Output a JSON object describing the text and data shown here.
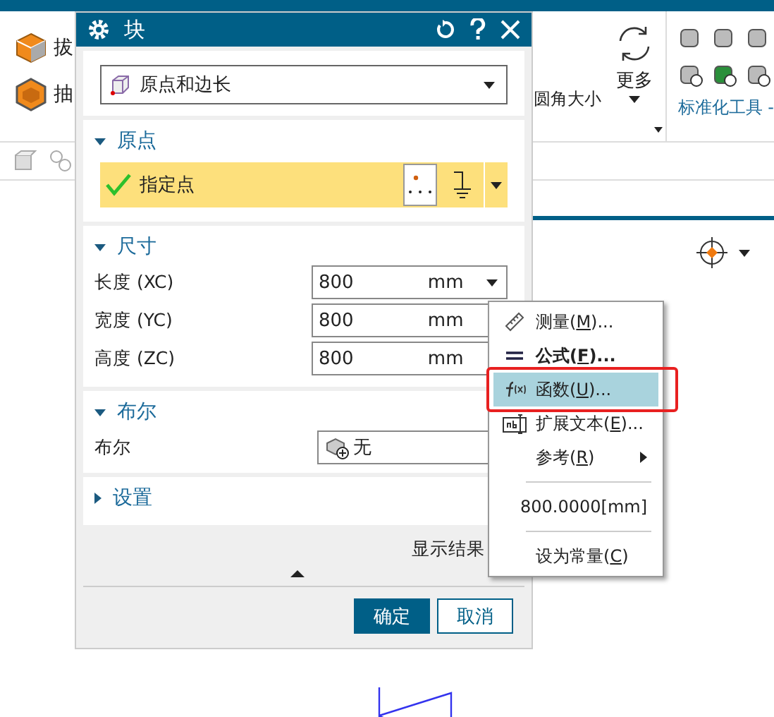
{
  "ribbon": {
    "left_items": [
      {
        "label": "拔"
      },
      {
        "label": "抽"
      }
    ],
    "mid_label": "圆角大小",
    "more_button": {
      "label": "更多"
    },
    "group_label": "标准化工具 -"
  },
  "dialog": {
    "title": "块",
    "type_dropdown": {
      "value": "原点和边长"
    },
    "sections": [
      {
        "kind": "point",
        "title": "原点",
        "expanded": true,
        "label": "指定点",
        "specified": true
      },
      {
        "kind": "fields",
        "title": "尺寸",
        "expanded": true,
        "fields": [
          {
            "label": "长度 (XC)",
            "value": "800",
            "unit": "mm",
            "has_menu_button": true
          },
          {
            "label": "宽度 (YC)",
            "value": "800",
            "unit": "mm",
            "has_menu_button": false
          },
          {
            "label": "高度 (ZC)",
            "value": "800",
            "unit": "mm",
            "has_menu_button": false
          }
        ]
      },
      {
        "kind": "select",
        "title": "布尔",
        "expanded": true,
        "label": "布尔",
        "value": "无"
      },
      {
        "kind": "empty",
        "title": "设置",
        "expanded": false
      }
    ],
    "show_result": "显示结果",
    "buttons": [
      {
        "label": "确定",
        "primary": true
      },
      {
        "label": "取消",
        "primary": false
      }
    ]
  },
  "context_menu": [
    {
      "kind": "item",
      "before": "测量(",
      "key": "M",
      "after": ")...",
      "bold": false,
      "selected": false,
      "submenu": false
    },
    {
      "kind": "item",
      "before": "公式(",
      "key": "F",
      "after": ")...",
      "bold": true,
      "selected": false,
      "submenu": false
    },
    {
      "kind": "item",
      "before": "函数(",
      "key": "U",
      "after": ")...",
      "bold": false,
      "selected": true,
      "submenu": false
    },
    {
      "kind": "item",
      "before": "扩展文本(",
      "key": "E",
      "after": ")...",
      "bold": false,
      "selected": false,
      "submenu": false
    },
    {
      "kind": "item",
      "before": "参考(",
      "key": "R",
      "after": ")",
      "bold": false,
      "selected": false,
      "submenu": true
    },
    {
      "kind": "separator"
    },
    {
      "kind": "item",
      "before": "800.0000[mm]",
      "bold": false,
      "selected": false,
      "submenu": false
    },
    {
      "kind": "separator"
    },
    {
      "kind": "item",
      "before": "设为常量(",
      "key": "C",
      "after": ")",
      "bold": false,
      "selected": false,
      "submenu": false
    }
  ]
}
